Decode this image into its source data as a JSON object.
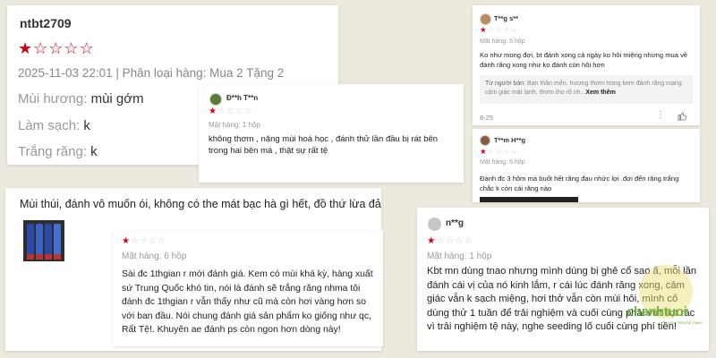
{
  "colors": {
    "background": "#ece9df",
    "star_filled": "#d0011b",
    "star_empty": "#cfcfcf",
    "watermark_green": "#60aa28"
  },
  "review1": {
    "user": "ntbt2709",
    "rating": 1,
    "max_rating": 5,
    "meta": "2025-11-03 22:01 | Phân loại hàng: Mua 2 Tặng 2",
    "attributes": [
      {
        "label": "Mùi hương:",
        "value": "mùi gớm"
      },
      {
        "label": "Làm sạch:",
        "value": "k"
      },
      {
        "label": "Trắng răng:",
        "value": "k"
      }
    ]
  },
  "review2": {
    "user": "Đ**h T**n",
    "rating": 1,
    "variant": "Mặt hàng: 1 hộp",
    "text": "không thơm , nặng mùi hoá học , đánh thử lần đầu bị rát bên trong hai bên má , thật sự rất tệ"
  },
  "review3": {
    "user": "T**g s**",
    "rating": 1,
    "variant": "Mặt hàng: 6 hộp",
    "text": "Ko như mong đợi, bt đánh xong cả ngày ko hôi miệng nhưng mua về đánh răng xong như ko đánh còn hôi hơn",
    "seller_reply_label": "Từ người bán:",
    "seller_reply": " Bạn thân mến, hương thơm trong kem đánh răng mang cảm giác mát lạnh, thơm tho rõ nh...",
    "see_more": "Xem thêm",
    "date": "8-25",
    "icons": [
      "more-icon",
      "like-icon"
    ]
  },
  "review4": {
    "user": "T**m H**g",
    "rating": 1,
    "variant": "Mặt hàng: 6 hộp",
    "text": "Đánh đc 3 hôm mà buốt hết răng đau nhức lợi .đợi đến răng trắng  chắc k còn cái răng nào"
  },
  "review5": {
    "text": "Mùi thúi, đánh vô muốn ói, không có the mát bạc hà gì hết, đồ thứ lừa đảo."
  },
  "review6": {
    "rating": 1,
    "variant": "Mặt hàng: 6 hộp",
    "text": "Sài đc 1thgian r mới đánh giá. Kem có mùi khá kỳ, hàng xuất sứ Trung Quốc khó tin, nói là đánh sẽ trắng răng nhma tôi đánh đc 1thgian r vẫn thấy như cũ mà còn hơi vàng hơn so với ban đầu. Nói chung đánh giá sản phẩm ko giống như qc, Rất Tệ!. Khuyên ae đánh ps còn ngon hơn dòng này!"
  },
  "review7": {
    "user": "n**g",
    "rating": 1,
    "variant": "Mặt hàng: 1 hộp",
    "text": "Kbt mn dùng tnao nhưng mình dùng bị ghê cổ sao ấ, mỗi lần đánh cái vị của nó kinh lắm, r cái lúc đánh răng xong, cảm giác vẫn k sạch miệng, hơi thở vẫn còn mùi hôi, mình cố dùng thử 1 tuần để trải nghiệm và cuối cùng phải vứt sọt rác vì trải nghiệm tệ này, nghe seeding lố cuối cùng phí tiền!"
  },
  "watermark": {
    "brand": "chanhtuoi",
    "tagline": "KIẾM TIỀN DỄ DÀNG"
  }
}
